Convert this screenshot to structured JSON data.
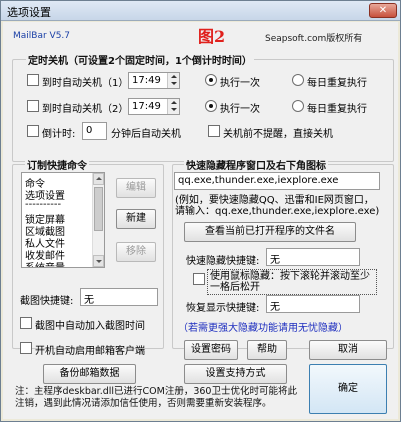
{
  "window": {
    "title": "选项设置",
    "close_label": "✕"
  },
  "header": {
    "brand": "MailBar V5.7",
    "figure_label": "图2",
    "site": "Seapsoft.com版权所有"
  },
  "timed_shutdown": {
    "legend": "定时关机（可设置2个固定时间，1个倒计时时间）",
    "rows": [
      {
        "label": "到时自动关机（1）",
        "time": "17:49",
        "opt_once": "执行一次",
        "opt_daily": "每日重复执行",
        "checked": false,
        "selected": "once"
      },
      {
        "label": "到时自动关机（2）",
        "time": "17:49",
        "opt_once": "执行一次",
        "opt_daily": "每日重复执行",
        "checked": false,
        "selected": "once"
      }
    ],
    "countdown_label": "倒计时:",
    "countdown_value": "0",
    "countdown_suffix": "分钟后自动关机",
    "no_prompt_label": "关机前不提醒，直接关机"
  },
  "quick_commands": {
    "legend": "订制快捷命令",
    "items": [
      "命令",
      "选项设置",
      "----------",
      "锁定屏幕",
      "区域截图",
      "私人文件",
      "收发邮件",
      "系统音量"
    ],
    "edit_label": "编辑",
    "new_label": "新建",
    "remove_label": "移除",
    "capture_hotkey_label": "截图快捷键:",
    "capture_hotkey_value": "无",
    "capture_time_label": "截图中自动加入截图时间"
  },
  "quick_hide": {
    "legend": "快速隐藏程序窗口及右下角图标",
    "programs": "qq.exe,thunder.exe,iexplore.exe",
    "example": "(例如，要快速隐藏QQ、迅雷和IE网页窗口，请输入：qq.exe,thunder.exe,iexplore.exe)",
    "view_button": "查看当前已打开程序的文件名",
    "hide_hotkey_label": "快速隐藏快捷键:",
    "hide_hotkey_value": "无",
    "mouse_hide_label": "使用鼠标隐藏：按下滚轮并滚动至少一格后松开",
    "restore_hotkey_label": "恢复显示快捷键:",
    "restore_hotkey_value": "无",
    "note": "（若需更强大隐藏功能请用无忧隐藏）"
  },
  "bottom": {
    "autostart_label": "开机自动启用邮箱客户端",
    "set_password": "设置密码",
    "help": "帮助",
    "cancel": "取消",
    "backup": "备份邮箱数据",
    "support": "设置支持方式",
    "ok": "确定",
    "footnote": "注：主程序deskbar.dll已进行COM注册，360卫士优化时可能将此注销，遇到此情况请添加信任使用，否则需要重新安装程序。"
  }
}
